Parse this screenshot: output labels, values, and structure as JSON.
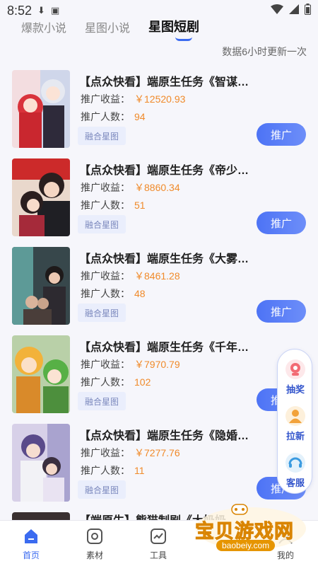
{
  "status_bar": {
    "time": "8:52"
  },
  "tabs": [
    {
      "label": "爆款小说"
    },
    {
      "label": "星图小说"
    },
    {
      "label": "星图短剧"
    }
  ],
  "update_note": "数据6小时更新一次",
  "cards": [
    {
      "title": "【点众快看】端原生任务《智谋…",
      "income_label": "推广收益：",
      "income": "￥12520.93",
      "users_label": "推广人数：",
      "users": "94",
      "tag": "融合星图",
      "button": "推广"
    },
    {
      "title": "【点众快看】端原生任务《帝少…",
      "income_label": "推广收益：",
      "income": "￥8860.34",
      "users_label": "推广人数：",
      "users": "51",
      "tag": "融合星图",
      "button": "推广"
    },
    {
      "title": "【点众快看】端原生任务《大雾…",
      "income_label": "推广收益：",
      "income": "￥8461.28",
      "users_label": "推广人数：",
      "users": "48",
      "tag": "融合星图",
      "button": "推广"
    },
    {
      "title": "【点众快看】端原生任务《千年…",
      "income_label": "推广收益：",
      "income": "￥7970.79",
      "users_label": "推广人数：",
      "users": "102",
      "tag": "融合星图",
      "button": "推广"
    },
    {
      "title": "【点众快看】端原生任务《隐婚…",
      "income_label": "推广收益：",
      "income": "￥7277.76",
      "users_label": "推广人数：",
      "users": "11",
      "tag": "融合星图",
      "button": "推广"
    },
    {
      "title": "【端原生】熊猫制剧《大奶奶…"
    }
  ],
  "float_menu": [
    {
      "label": "抽奖",
      "icon": "lottery-icon"
    },
    {
      "label": "拉新",
      "icon": "invite-icon"
    },
    {
      "label": "客服",
      "icon": "service-icon"
    }
  ],
  "bottom_nav": [
    {
      "label": "首页",
      "icon": "home-icon"
    },
    {
      "label": "素材",
      "icon": "material-icon"
    },
    {
      "label": "工具",
      "icon": "tools-icon"
    },
    {
      "label": "我的",
      "icon": "profile-icon"
    }
  ],
  "watermark": {
    "main": "宝贝游戏网",
    "sub": "baobeiy.com"
  },
  "colors": {
    "accent": "#3b6bf0",
    "income": "#f08a2a"
  }
}
